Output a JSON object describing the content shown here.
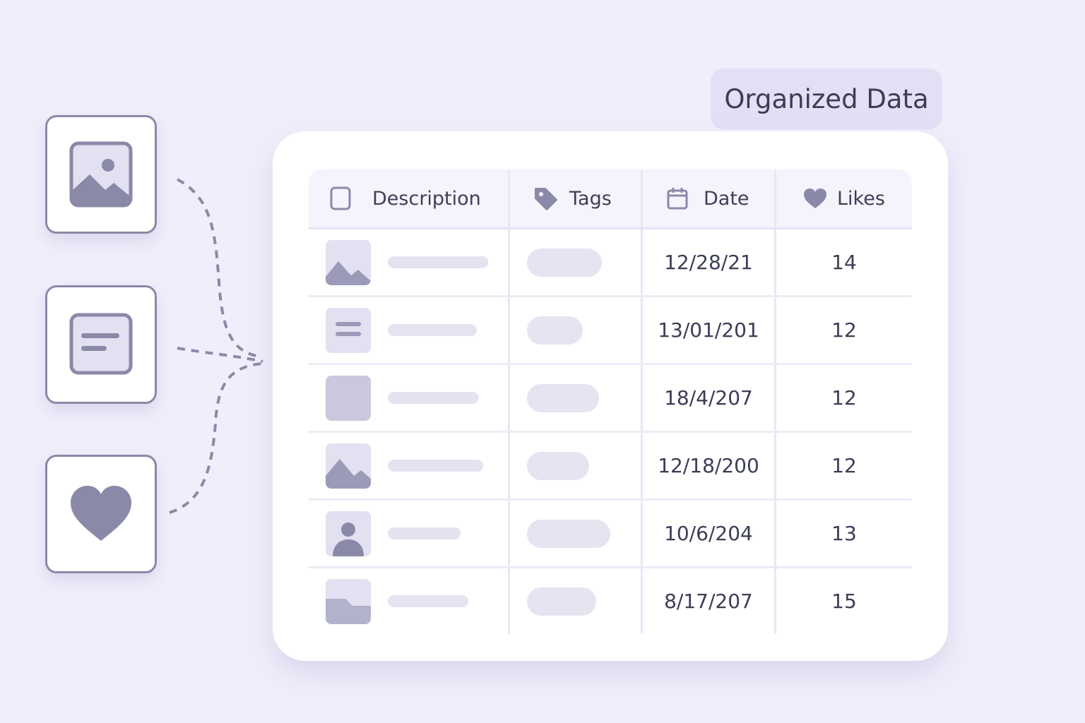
{
  "badge": {
    "label": "Organized Data"
  },
  "table": {
    "headers": {
      "description": "Description",
      "tags": "Tags",
      "date": "Date",
      "likes": "Likes"
    },
    "rows": [
      {
        "thumb": "mountain-image-icon",
        "date": "12/28/21",
        "likes": "14"
      },
      {
        "thumb": "text-lines-icon",
        "date": "13/01/201",
        "likes": "12"
      },
      {
        "thumb": "blank-square-icon",
        "date": "18/4/207",
        "likes": "12"
      },
      {
        "thumb": "mountain-image-icon",
        "date": "12/18/200",
        "likes": "12"
      },
      {
        "thumb": "person-icon",
        "date": "10/6/204",
        "likes": "13"
      },
      {
        "thumb": "landscape-icon",
        "date": "8/17/207",
        "likes": "15"
      }
    ]
  },
  "sources": [
    {
      "icon": "image-icon"
    },
    {
      "icon": "document-icon"
    },
    {
      "icon": "heart-icon"
    }
  ],
  "colors": {
    "background": "#f1eefb",
    "icon": "#8a89a8",
    "badge": "#e3dff4",
    "panel": "#ffffff"
  }
}
